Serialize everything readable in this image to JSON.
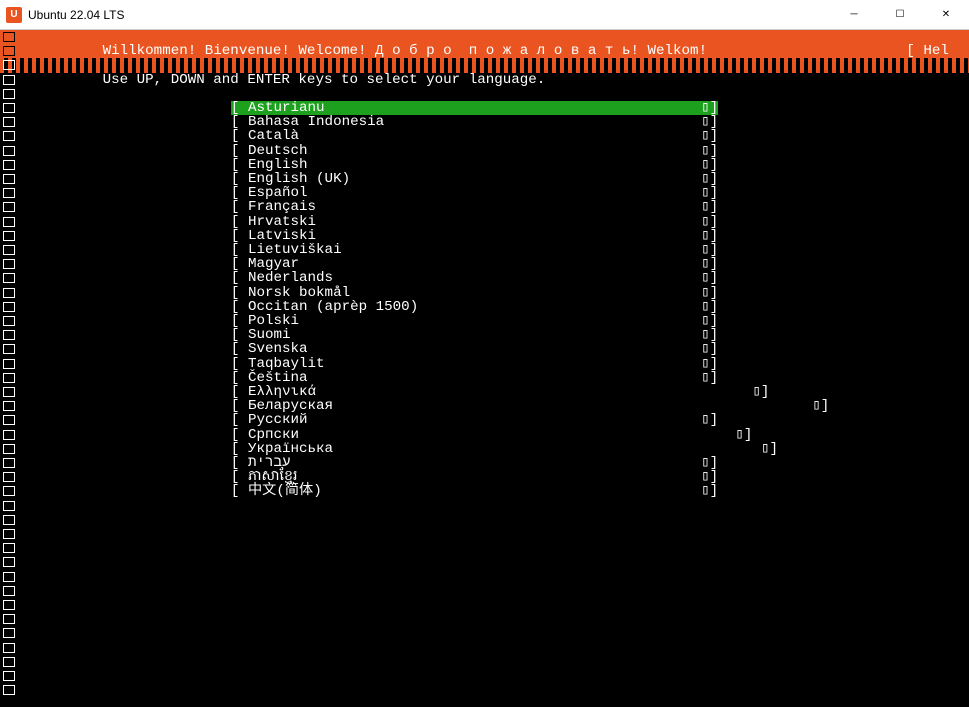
{
  "window": {
    "title": "Ubuntu 22.04 LTS",
    "icon_letter": "U",
    "min": "─",
    "max": "☐",
    "close": "✕"
  },
  "header": {
    "welcome": "Willkommen! Bienvenue! Welcome! Д о б р о  п о ж а л о в а т ь! Welkom!",
    "help": "[ Hel"
  },
  "instruction": "Use UP, DOWN and ENTER keys to select your language.",
  "languages": [
    "Asturianu",
    "Bahasa Indonesia",
    "Català",
    "Deutsch",
    "English",
    "English (UK)",
    "Español",
    "Français",
    "Hrvatski",
    "Latviski",
    "Lietuviškai",
    "Magyar",
    "Nederlands",
    "Norsk bokmål",
    "Occitan (aprèp 1500)",
    "Polski",
    "Suomi",
    "Svenska",
    "Taqbaylit",
    "Čeština",
    "Ελληνικά",
    "Беларуская",
    "Русский",
    "Српски",
    "Українська",
    "עברית",
    "ភាសាខ្មែរ",
    "中文(简体)"
  ],
  "selected_index": 0,
  "bracket_open": "[ ",
  "bracket_close": "]",
  "arrow_placeholder": "▯"
}
